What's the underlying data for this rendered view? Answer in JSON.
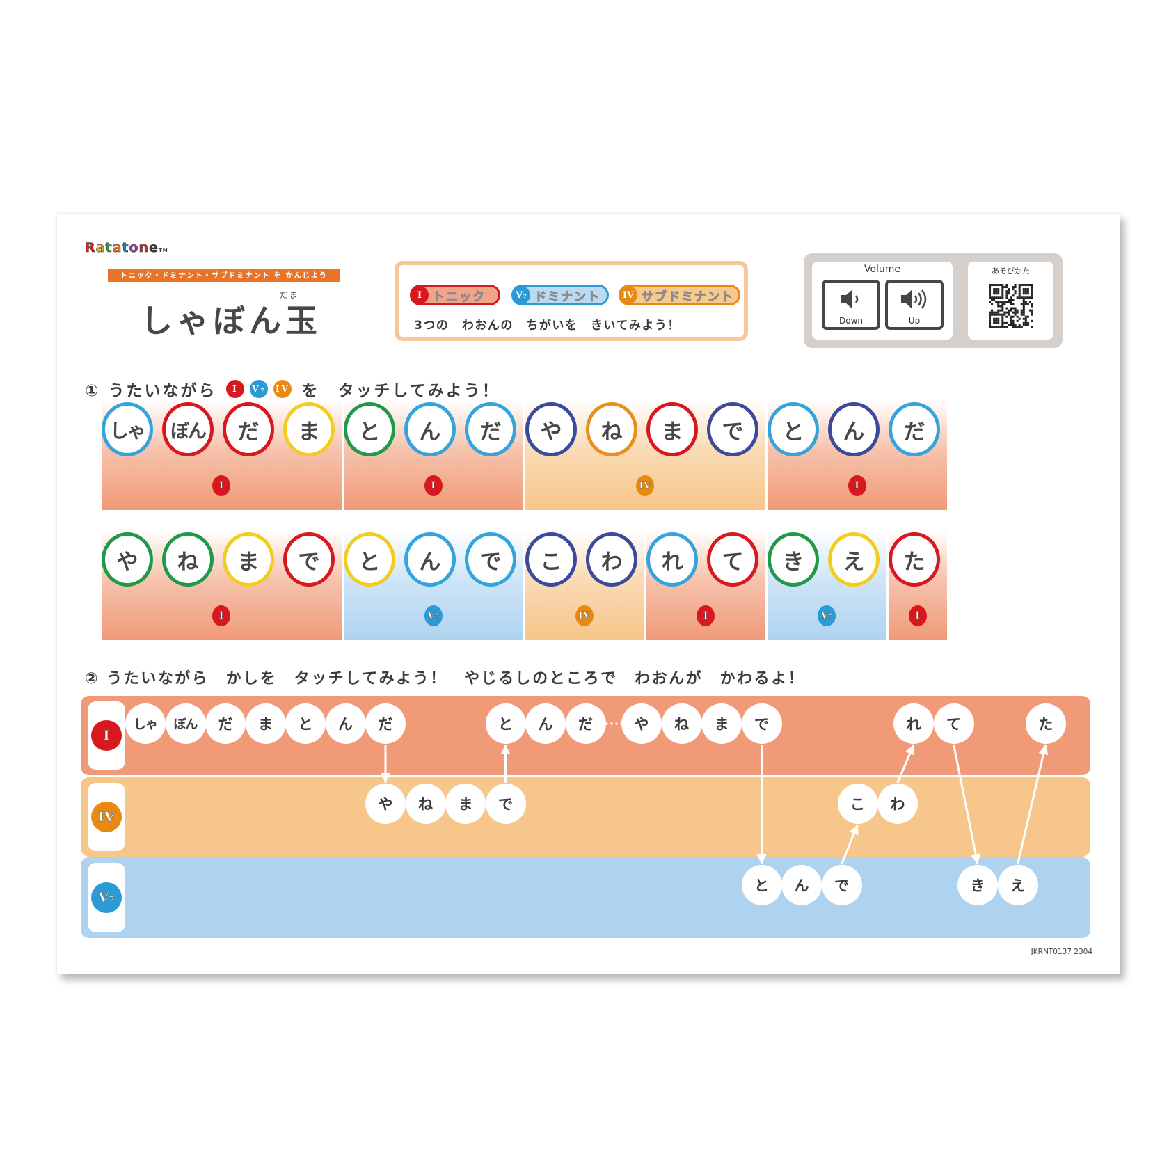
{
  "brand": {
    "name_letters": [
      "R",
      "a",
      "t",
      "a",
      "t",
      "o",
      "n",
      "e"
    ],
    "letter_colors": [
      "#d7262b",
      "#e9b620",
      "#2f9a4b",
      "#e86f25",
      "#2f7fc8",
      "#8a4aa6",
      "#d7262b",
      "#3b3b3b"
    ],
    "tm": "TM"
  },
  "header": {
    "banner": "トニック・ドミナント・サブドミナント を かんじよう",
    "title": "しゃぼん玉",
    "ruby": "だま"
  },
  "legend": {
    "chords": [
      {
        "symbol": "I",
        "name": "トニック",
        "color": "#d7191f",
        "fill": "#f2a48a"
      },
      {
        "symbol": "V7",
        "name": "ドミナント",
        "color": "#2a9bd4",
        "fill": "#b9daf3"
      },
      {
        "symbol": "IV",
        "name": "サブドミナント",
        "color": "#e88a12",
        "fill": "#f7c98c"
      }
    ],
    "note": "3つの　わおんの　ちがいを　きいてみよう！"
  },
  "volume": {
    "title": "Volume",
    "down_label": "Down",
    "up_label": "Up"
  },
  "howto": {
    "title": "あそびかた",
    "qr": "qr-code"
  },
  "section1": {
    "heading_pre": "① うたいながら",
    "heading_post": "を　タッチしてみよう！",
    "chords": [
      "I",
      "V7",
      "IV"
    ],
    "rows": [
      {
        "segments": [
          {
            "chord": "I",
            "syllables": [
              {
                "t": "しゃ",
                "ring": "blue"
              },
              {
                "t": "ぼん",
                "ring": "red"
              },
              {
                "t": "だ",
                "ring": "red"
              },
              {
                "t": "ま",
                "ring": "yellow"
              }
            ]
          },
          {
            "chord": "I",
            "syllables": [
              {
                "t": "と",
                "ring": "green"
              },
              {
                "t": "ん",
                "ring": "blue"
              },
              {
                "t": "だ",
                "ring": "blue"
              }
            ]
          },
          {
            "chord": "IV",
            "syllables": [
              {
                "t": "や",
                "ring": "navy"
              },
              {
                "t": "ね",
                "ring": "orange"
              },
              {
                "t": "ま",
                "ring": "red"
              },
              {
                "t": "で",
                "ring": "navy"
              }
            ]
          },
          {
            "chord": "I",
            "syllables": [
              {
                "t": "と",
                "ring": "blue"
              },
              {
                "t": "ん",
                "ring": "navy"
              },
              {
                "t": "だ",
                "ring": "blue"
              }
            ]
          }
        ]
      },
      {
        "segments": [
          {
            "chord": "I",
            "syllables": [
              {
                "t": "や",
                "ring": "green"
              },
              {
                "t": "ね",
                "ring": "green"
              },
              {
                "t": "ま",
                "ring": "yellow"
              },
              {
                "t": "で",
                "ring": "red"
              }
            ]
          },
          {
            "chord": "V7",
            "syllables": [
              {
                "t": "と",
                "ring": "yellow"
              },
              {
                "t": "ん",
                "ring": "blue"
              },
              {
                "t": "で",
                "ring": "blue"
              }
            ]
          },
          {
            "chord": "IV",
            "syllables": [
              {
                "t": "こ",
                "ring": "navy"
              },
              {
                "t": "わ",
                "ring": "navy"
              }
            ]
          },
          {
            "chord": "I",
            "syllables": [
              {
                "t": "れ",
                "ring": "blue"
              },
              {
                "t": "て",
                "ring": "red"
              }
            ]
          },
          {
            "chord": "V7",
            "syllables": [
              {
                "t": "き",
                "ring": "green"
              },
              {
                "t": "え",
                "ring": "yellow"
              }
            ]
          },
          {
            "chord": "I",
            "syllables": [
              {
                "t": "た",
                "ring": "red"
              }
            ]
          }
        ]
      }
    ]
  },
  "ring_colors": {
    "blue": "#35a3dc",
    "red": "#d7191f",
    "yellow": "#f2cd1e",
    "green": "#1f9a4a",
    "navy": "#3c4a9c",
    "orange": "#e8901c"
  },
  "section2": {
    "heading": "② うたいながら　かしを　タッチしてみよう！　やじるしのところで　わおんが　かわるよ！",
    "bands": [
      {
        "chord": "I",
        "color": "#f09a78"
      },
      {
        "chord": "IV",
        "color": "#f7c68a"
      },
      {
        "chord": "V7",
        "color": "#aed3f0"
      }
    ],
    "notes": [
      {
        "t": "しゃ",
        "band": 0,
        "col": 0
      },
      {
        "t": "ぼん",
        "band": 0,
        "col": 1
      },
      {
        "t": "だ",
        "band": 0,
        "col": 2
      },
      {
        "t": "ま",
        "band": 0,
        "col": 3
      },
      {
        "t": "と",
        "band": 0,
        "col": 4
      },
      {
        "t": "ん",
        "band": 0,
        "col": 5
      },
      {
        "t": "だ",
        "band": 0,
        "col": 6
      },
      {
        "t": "や",
        "band": 1,
        "col": 6
      },
      {
        "t": "ね",
        "band": 1,
        "col": 7
      },
      {
        "t": "ま",
        "band": 1,
        "col": 8
      },
      {
        "t": "で",
        "band": 1,
        "col": 9
      },
      {
        "t": "と",
        "band": 0,
        "col": 9
      },
      {
        "t": "ん",
        "band": 0,
        "col": 10
      },
      {
        "t": "だ",
        "band": 0,
        "col": 11
      },
      {
        "t": "や",
        "band": 0,
        "col": 12.4
      },
      {
        "t": "ね",
        "band": 0,
        "col": 13.4
      },
      {
        "t": "ま",
        "band": 0,
        "col": 14.4
      },
      {
        "t": "で",
        "band": 0,
        "col": 15.4
      },
      {
        "t": "と",
        "band": 2,
        "col": 15.4
      },
      {
        "t": "ん",
        "band": 2,
        "col": 16.4
      },
      {
        "t": "で",
        "band": 2,
        "col": 17.4
      },
      {
        "t": "こ",
        "band": 1,
        "col": 17.8
      },
      {
        "t": "わ",
        "band": 1,
        "col": 18.8
      },
      {
        "t": "れ",
        "band": 0,
        "col": 19.2
      },
      {
        "t": "て",
        "band": 0,
        "col": 20.2
      },
      {
        "t": "き",
        "band": 2,
        "col": 20.8
      },
      {
        "t": "え",
        "band": 2,
        "col": 21.8
      },
      {
        "t": "た",
        "band": 0,
        "col": 22.5
      }
    ],
    "code": "JKRNT0137 2304"
  }
}
